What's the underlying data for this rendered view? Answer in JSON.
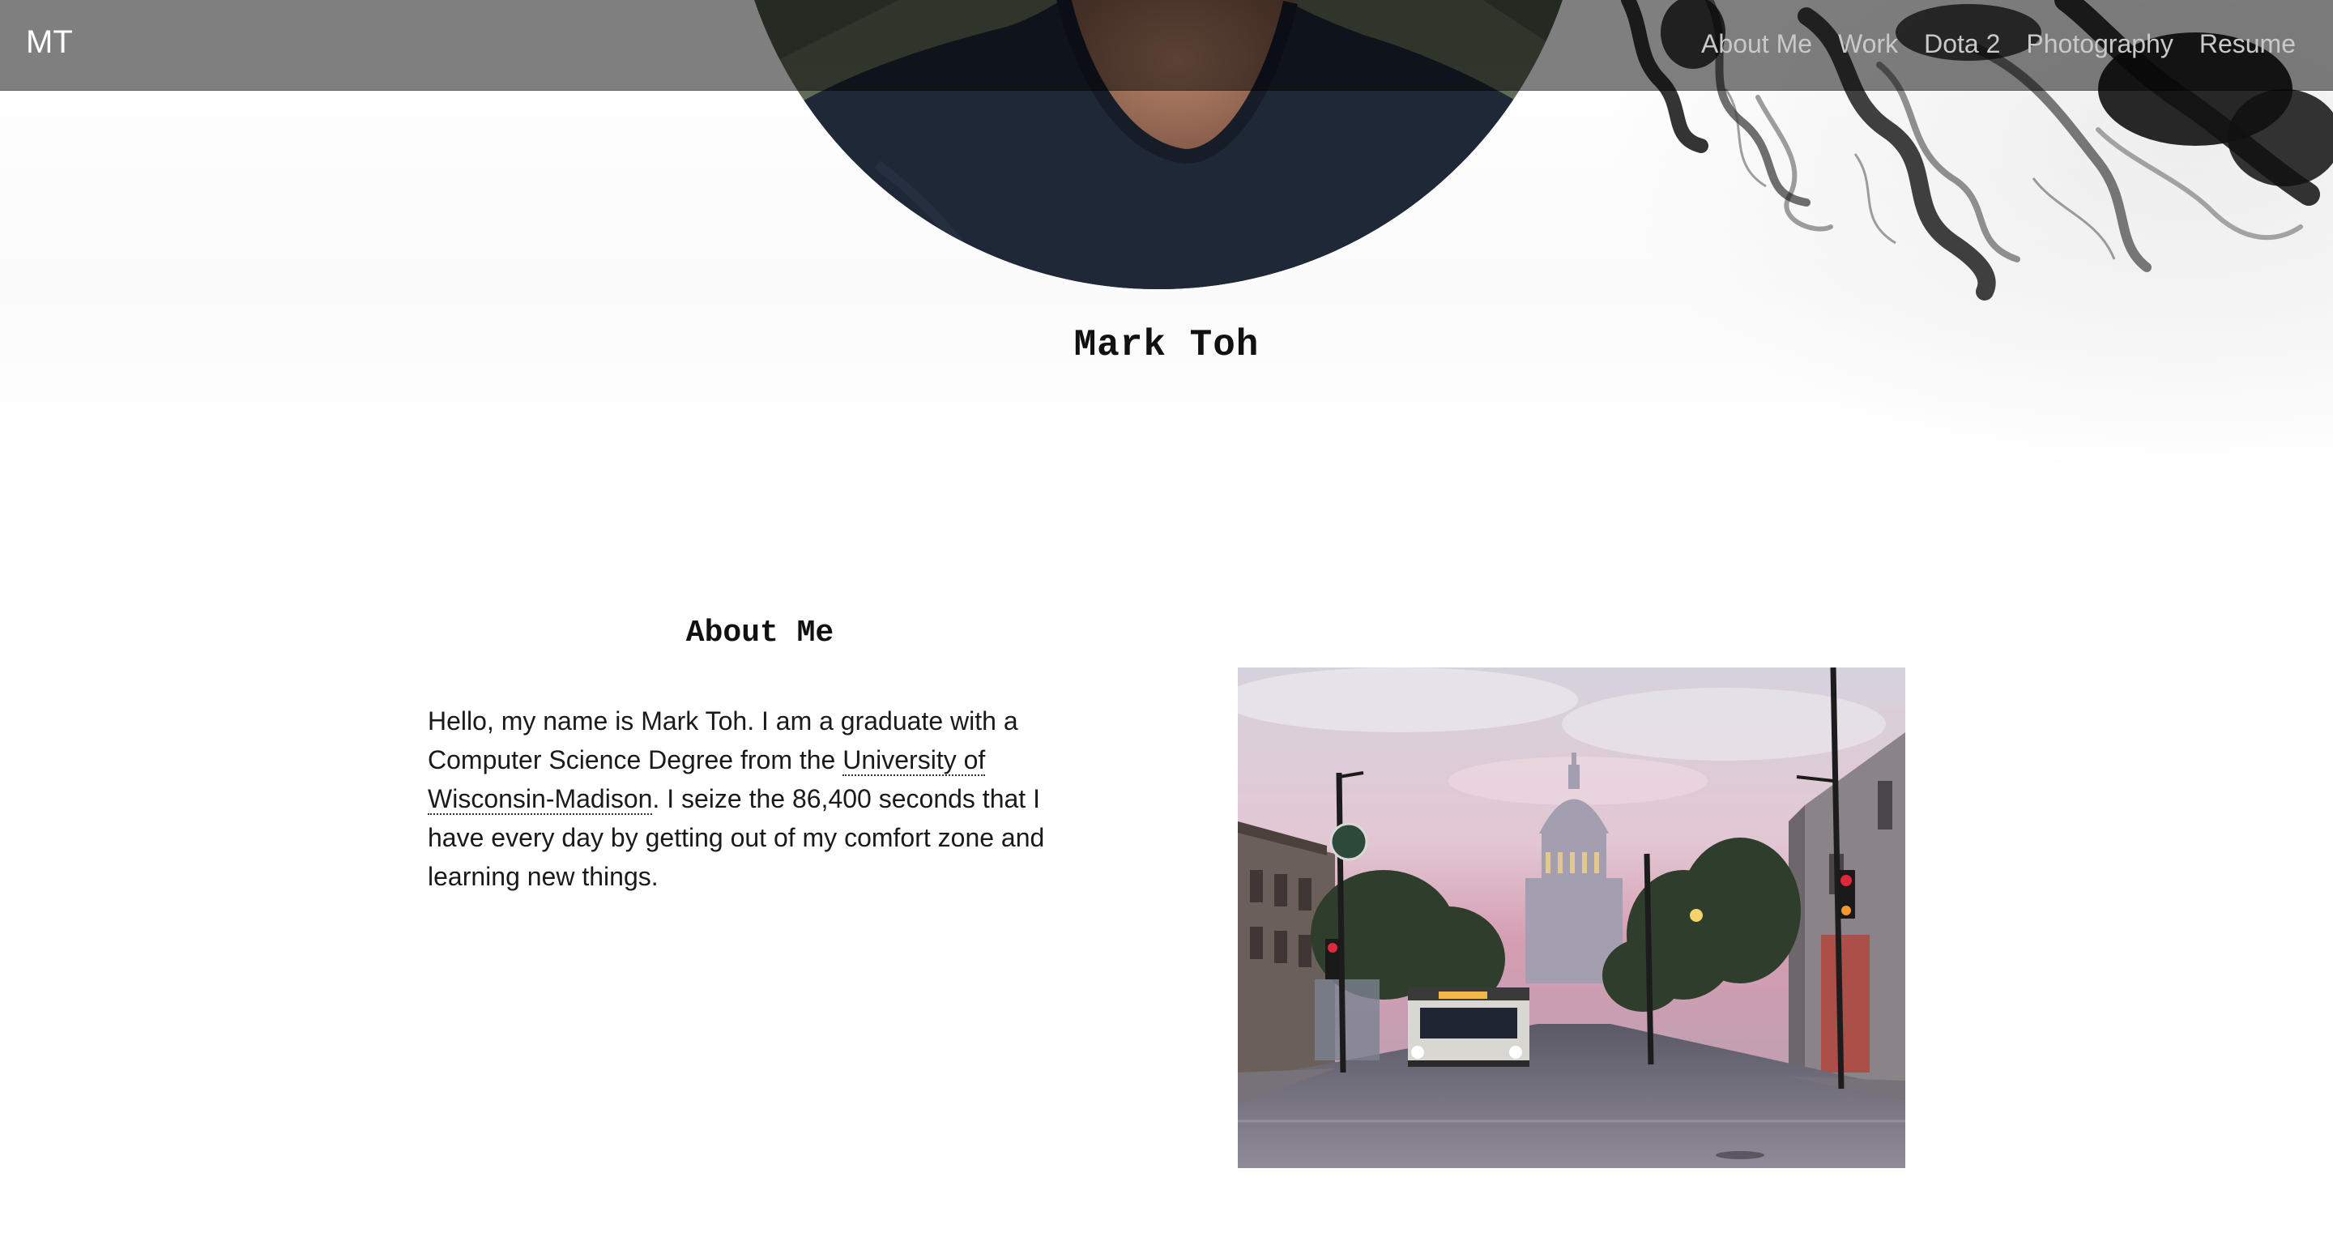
{
  "navbar": {
    "brand": "MT",
    "links": [
      "About Me",
      "Work",
      "Dota 2",
      "Photography",
      "Resume"
    ]
  },
  "hero": {
    "name": "Mark Toh",
    "avatar": "profile-photo"
  },
  "about": {
    "title": "About Me",
    "text_before_link": "Hello, my name is Mark Toh. I am a graduate with a Computer Science Degree from the ",
    "link_text": "University of Wisconsin-Madison",
    "text_after_link": ". I seize the 86,400 seconds that I have every day by getting out of my comfort zone and learning new things.",
    "photo": "state-street-capitol-photo"
  },
  "colors": {
    "navbar_bg": "#808080",
    "nav_link": "#c9c9c9",
    "brand": "#ffffff",
    "text": "#1a1a1a"
  }
}
